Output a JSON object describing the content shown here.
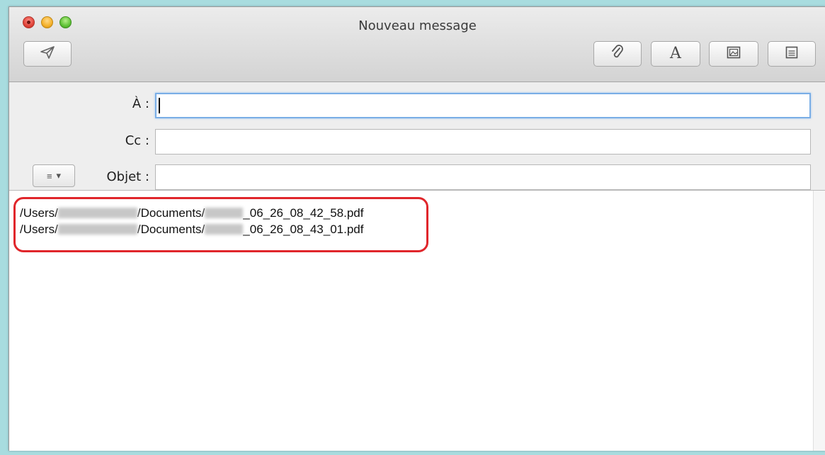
{
  "window": {
    "title": "Nouveau message"
  },
  "toolbar": {
    "send": {
      "icon": "send-icon"
    },
    "attach": {
      "icon": "paperclip-icon"
    },
    "fonts": {
      "icon": "fonts-icon",
      "glyph": "A"
    },
    "photo": {
      "icon": "photo-browser-icon"
    },
    "template": {
      "icon": "stationery-icon"
    }
  },
  "headers": {
    "to_label": "À :",
    "cc_label": "Cc :",
    "subject_label": "Objet :",
    "to_value": "",
    "cc_value": "",
    "subject_value": "",
    "menu_button": {
      "glyph": "≡",
      "arrow": "▾"
    }
  },
  "body": {
    "attachments": [
      {
        "prefix": "/Users/",
        "middle": "/Documents/",
        "suffix": "_06_26_08_42_58.pdf"
      },
      {
        "prefix": "/Users/",
        "middle": "/Documents/",
        "suffix": "_06_26_08_43_01.pdf"
      }
    ]
  },
  "colors": {
    "highlight": "#e0262b",
    "background": "#a8dcdf",
    "focus_ring": "#7aaee6"
  }
}
